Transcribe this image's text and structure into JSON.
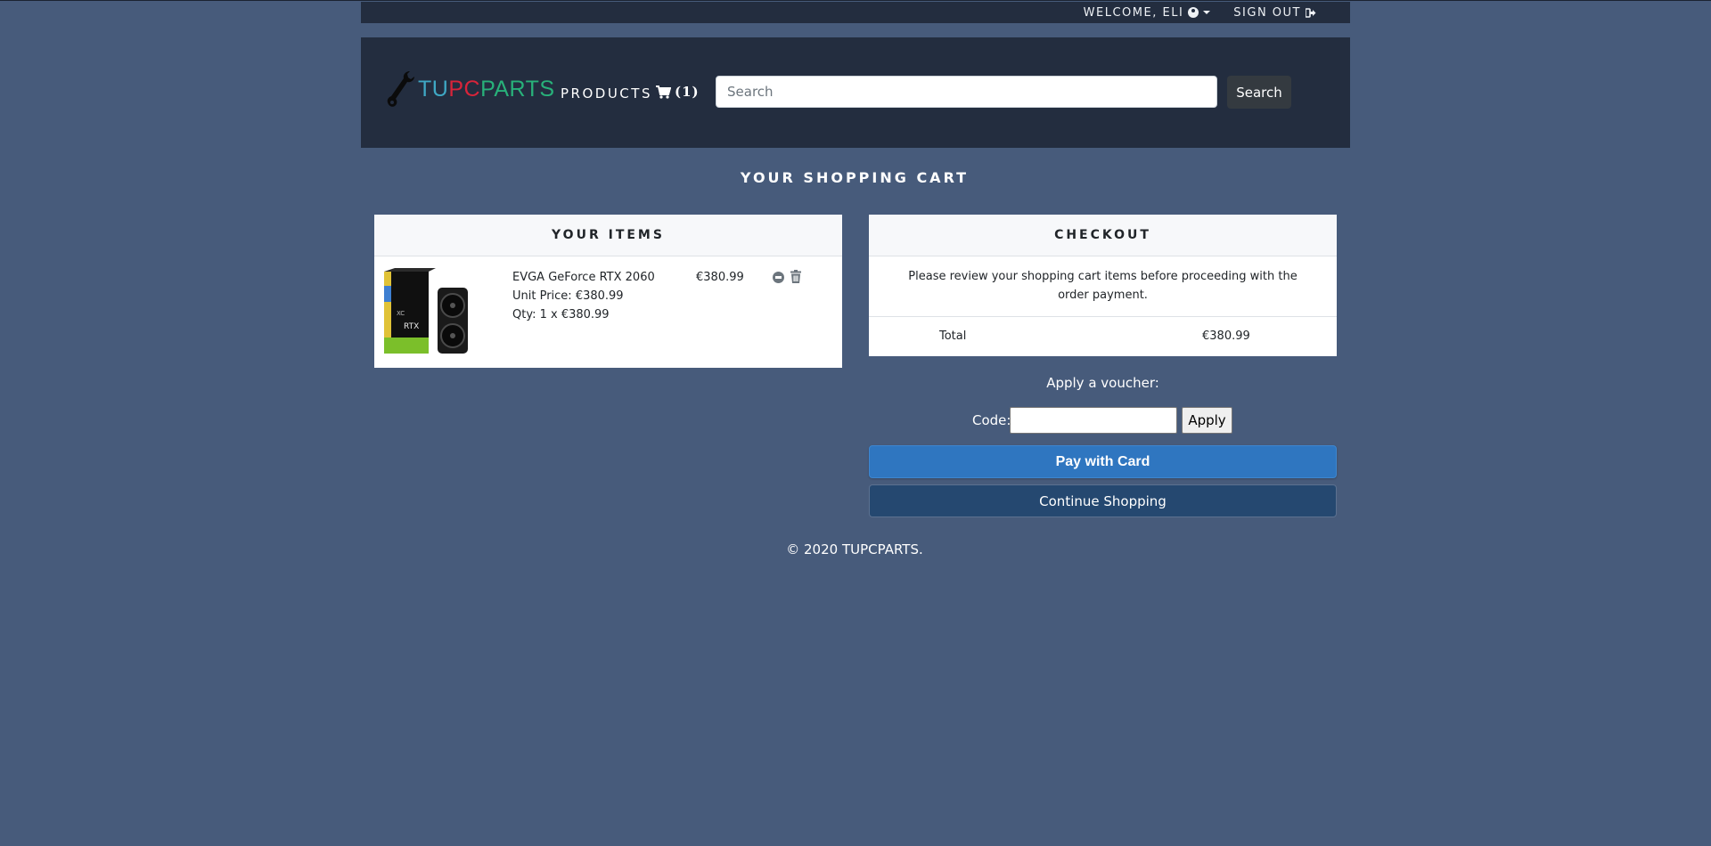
{
  "topbar": {
    "welcome": "WELCOME, ELI",
    "signout": "SIGN OUT"
  },
  "navbar": {
    "brand_part1": "TU",
    "brand_part2": "PC",
    "brand_part3": "PARTS",
    "products": "PRODUCTS",
    "cart_count": "(1)",
    "search_placeholder": "Search",
    "search_button": "Search"
  },
  "page": {
    "title": "YOUR SHOPPING CART"
  },
  "items_panel": {
    "header": "YOUR ITEMS",
    "items": [
      {
        "name": "EVGA GeForce RTX 2060",
        "unit_price": "Unit Price: €380.99",
        "qty": "Qty: 1 x €380.99",
        "price": "€380.99"
      }
    ]
  },
  "checkout": {
    "header": "CHECKOUT",
    "message": "Please review your shopping cart items before proceeding with the order payment.",
    "total_label": "Total",
    "total_value": "€380.99"
  },
  "voucher": {
    "title": "Apply a voucher:",
    "code_label": "Code:",
    "apply_button": "Apply"
  },
  "actions": {
    "pay": "Pay with Card",
    "continue": "Continue Shopping"
  },
  "footer": {
    "copyright": "© 2020 TUPCPARTS."
  },
  "colors": {
    "background": "#475b7b",
    "navbar": "#232d3f",
    "pay_button": "#2f76c0",
    "continue_button": "#254870",
    "brand_tu": "#3fa8c4",
    "brand_pc": "#d8243a",
    "brand_parts": "#28b17a"
  },
  "icons": {
    "user": "user-circle-icon",
    "signout": "sign-out-icon",
    "cart": "shopping-cart-icon",
    "logo": "wrench-icon",
    "remove_one": "minus-circle-icon",
    "delete": "trash-icon"
  }
}
